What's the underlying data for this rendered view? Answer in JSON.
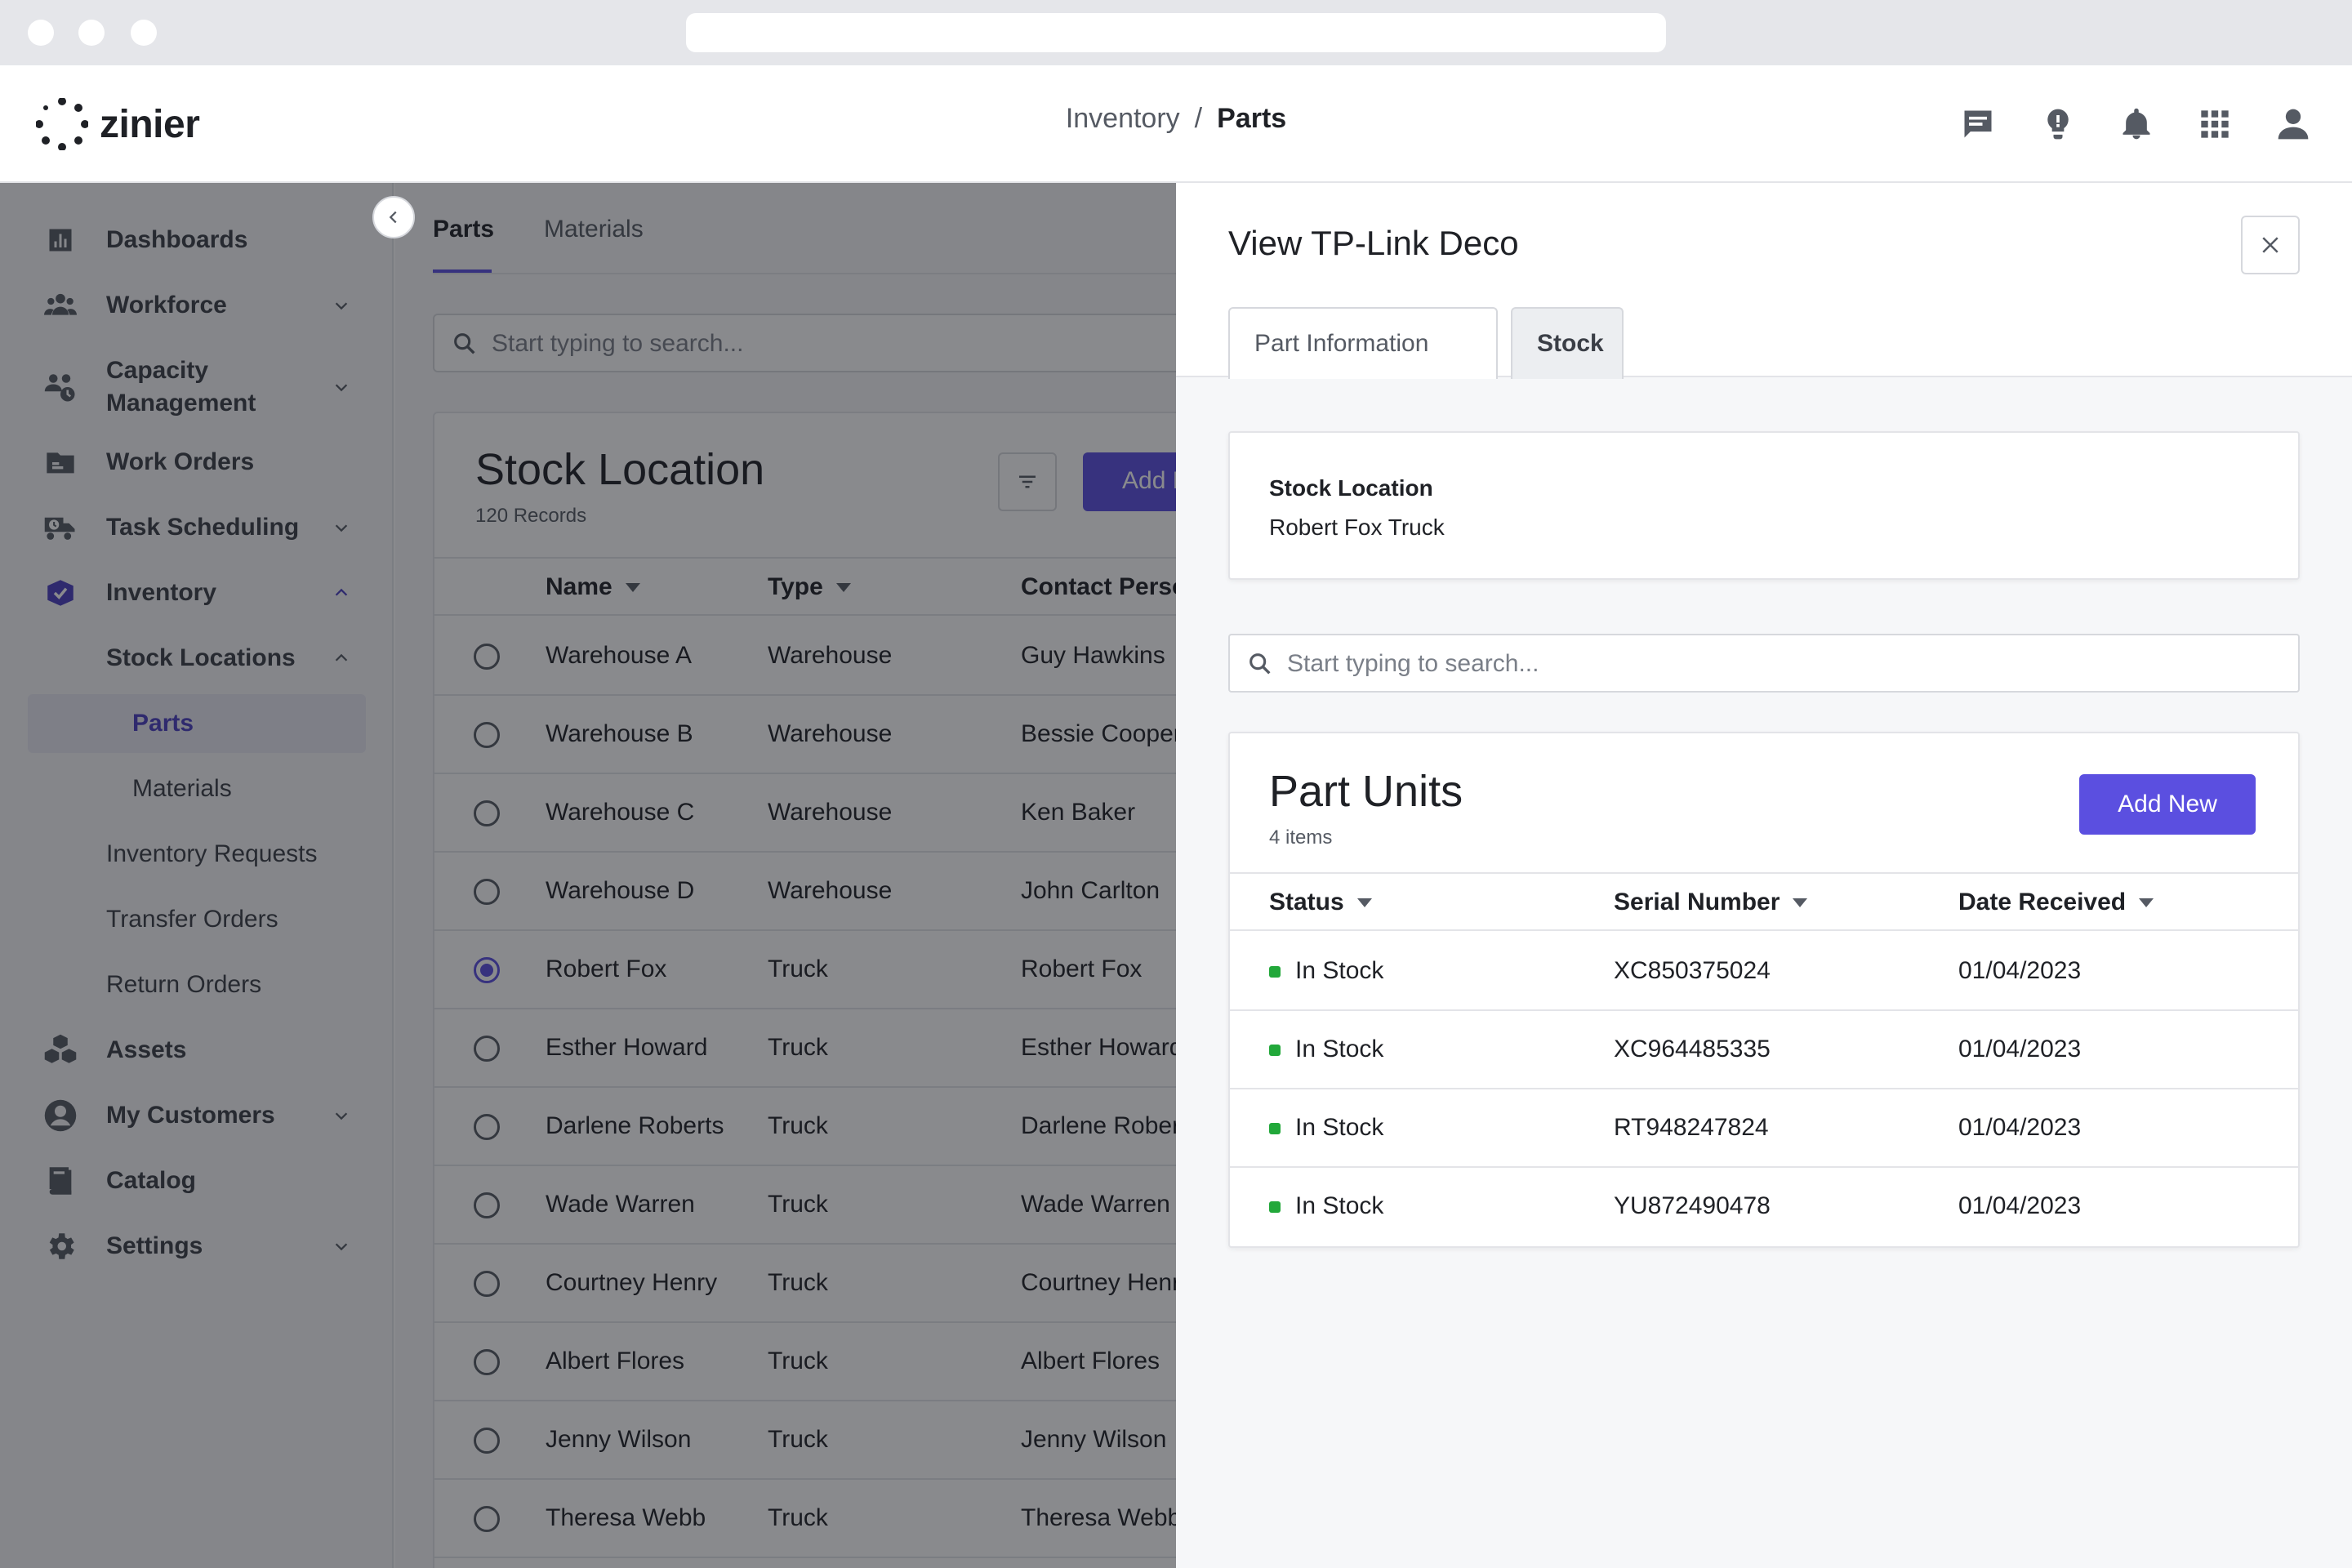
{
  "app": {
    "brand": "zinier",
    "breadcrumb": {
      "parent": "Inventory",
      "separator": "/",
      "current": "Parts"
    }
  },
  "header_icons": [
    "chat-icon",
    "lightbulb-icon",
    "bell-icon",
    "apps-grid-icon",
    "user-icon"
  ],
  "sidebar": {
    "items": [
      {
        "label": "Dashboards",
        "icon": "bar-chart-icon"
      },
      {
        "label": "Workforce",
        "icon": "people-icon"
      },
      {
        "label": "Capacity",
        "label2": "Management",
        "icon": "capacity-icon"
      },
      {
        "label": "Work Orders",
        "icon": "folder-icon"
      },
      {
        "label": "Task Scheduling",
        "icon": "truck-clock-icon"
      },
      {
        "label": "Inventory",
        "icon": "inventory-icon"
      },
      {
        "label": "Assets",
        "icon": "cubes-icon"
      },
      {
        "label": "My Customers",
        "icon": "account-circle-icon"
      },
      {
        "label": "Catalog",
        "icon": "book-icon"
      },
      {
        "label": "Settings",
        "icon": "gear-icon"
      }
    ],
    "inventory_sub": {
      "stock_locations": "Stock Locations",
      "parts": "Parts",
      "materials": "Materials",
      "inventory_requests": "Inventory Requests",
      "transfer_orders": "Transfer Orders",
      "return_orders": "Return Orders"
    }
  },
  "main": {
    "tabs": [
      "Parts",
      "Materials"
    ],
    "search_placeholder": "Start typing to search...",
    "card": {
      "title": "Stock Location",
      "subtitle": "120 Records",
      "add_button": "Add New",
      "columns": [
        "Name",
        "Type",
        "Contact Person"
      ],
      "rows": [
        {
          "name": "Warehouse A",
          "type": "Warehouse",
          "contact": "Guy Hawkins",
          "selected": false
        },
        {
          "name": "Warehouse B",
          "type": "Warehouse",
          "contact": "Bessie Cooper",
          "selected": false
        },
        {
          "name": "Warehouse C",
          "type": "Warehouse",
          "contact": "Ken Baker",
          "selected": false
        },
        {
          "name": "Warehouse D",
          "type": "Warehouse",
          "contact": "John Carlton",
          "selected": false
        },
        {
          "name": "Robert Fox",
          "type": "Truck",
          "contact": "Robert Fox",
          "selected": true
        },
        {
          "name": "Esther Howard",
          "type": "Truck",
          "contact": "Esther Howard",
          "selected": false
        },
        {
          "name": "Darlene Roberts",
          "type": "Truck",
          "contact": "Darlene Roberts",
          "selected": false
        },
        {
          "name": "Wade Warren",
          "type": "Truck",
          "contact": "Wade Warren",
          "selected": false
        },
        {
          "name": "Courtney Henry",
          "type": "Truck",
          "contact": "Courtney Henry",
          "selected": false
        },
        {
          "name": "Albert Flores",
          "type": "Truck",
          "contact": "Albert Flores",
          "selected": false
        },
        {
          "name": "Jenny Wilson",
          "type": "Truck",
          "contact": "Jenny Wilson",
          "selected": false
        },
        {
          "name": "Theresa Webb",
          "type": "Truck",
          "contact": "Theresa Webb",
          "selected": false
        }
      ]
    }
  },
  "drawer": {
    "title": "View TP-Link Deco",
    "tabs": {
      "part_information": "Part Information",
      "stock": "Stock"
    },
    "stock_location": {
      "label": "Stock Location",
      "value": "Robert Fox Truck"
    },
    "search_placeholder": "Start typing to search...",
    "part_units": {
      "title": "Part Units",
      "subtitle": "4 items",
      "add_button": "Add New",
      "columns": {
        "status": "Status",
        "serial": "Serial Number",
        "date": "Date Received"
      },
      "rows": [
        {
          "status": "In Stock",
          "serial": "XC850375024",
          "date": "01/04/2023"
        },
        {
          "status": "In Stock",
          "serial": "XC964485335",
          "date": "01/04/2023"
        },
        {
          "status": "In Stock",
          "serial": "RT948247824",
          "date": "01/04/2023"
        },
        {
          "status": "In Stock",
          "serial": "YU872490478",
          "date": "01/04/2023"
        }
      ]
    }
  },
  "colors": {
    "accent": "#5b4fe0",
    "in_stock": "#22a83a"
  }
}
